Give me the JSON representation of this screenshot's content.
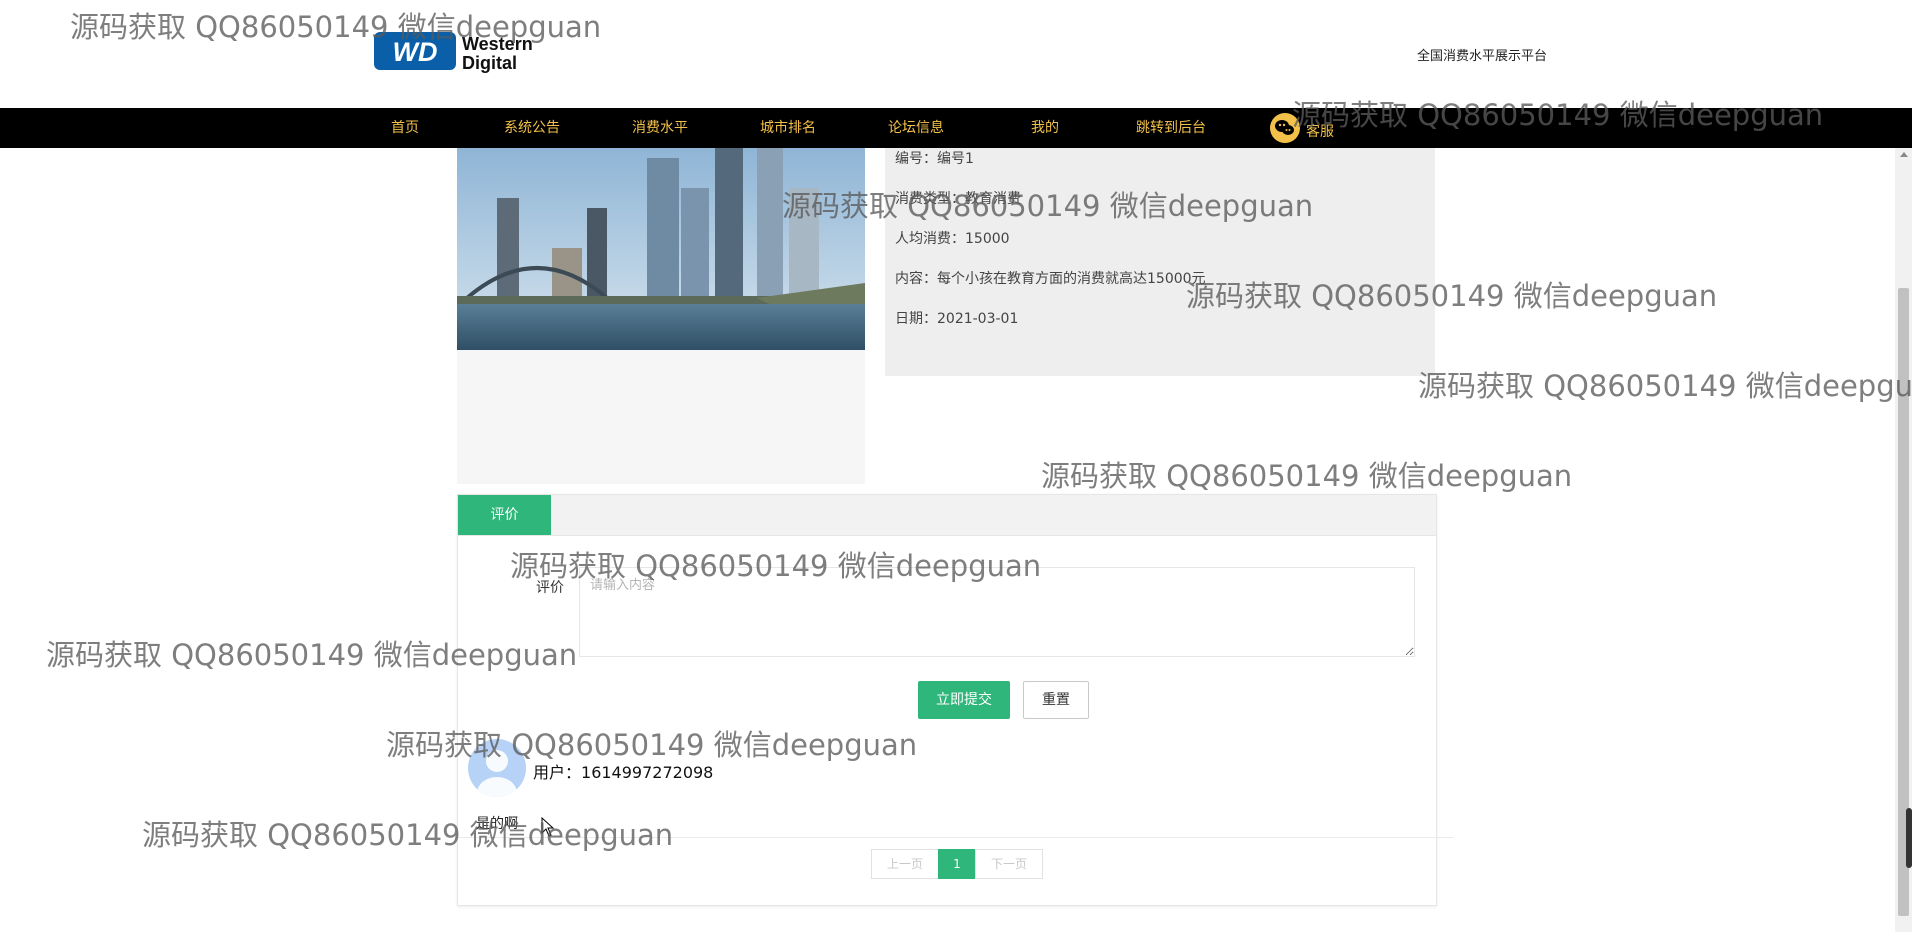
{
  "header": {
    "logo_text_1": "Western",
    "logo_text_2": "Digital",
    "logo_mark": "WD",
    "site_title": "全国消费水平展示平台"
  },
  "nav": {
    "items": [
      "首页",
      "系统公告",
      "消费水平",
      "城市排名",
      "论坛信息",
      "我的",
      "跳转到后台",
      "客服"
    ],
    "accent_color": "#f3c14a",
    "service_icon": "wechat-icon"
  },
  "detail": {
    "id_label": "编号：",
    "id_value": "编号1",
    "type_label": "消费类型：",
    "type_value": "教育消费",
    "avg_label": "人均消费：",
    "avg_value": "15000",
    "content_label": "内容：",
    "content_value": "每个小孩在教育方面的消费就高达15000元",
    "date_label": "日期：",
    "date_value": "2021-03-01"
  },
  "comment": {
    "tab_label": "评价",
    "form_label": "评价",
    "placeholder": "请输入内容",
    "submit_label": "立即提交",
    "reset_label": "重置",
    "accent_color": "#2fb67a"
  },
  "comments": [
    {
      "user_label": "用户：",
      "user_id": "1614997272098",
      "text": "是的啊"
    }
  ],
  "pagination": {
    "prev_label": "上一页",
    "current_page": "1",
    "next_label": "下一页"
  },
  "watermark": {
    "text": "源码获取 QQ86050149 微信deepguan"
  }
}
